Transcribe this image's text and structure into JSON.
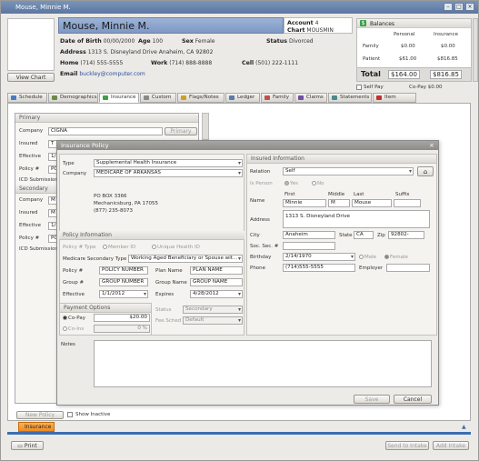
{
  "window": {
    "title": "Mouse, Minnie M."
  },
  "patient": {
    "name": "Mouse, Minnie M.",
    "view_chart": "View Chart",
    "dob_label": "Date of Birth",
    "dob": "00/00/2000",
    "age_label": "Age",
    "age": "100",
    "sex_label": "Sex",
    "sex": "Female",
    "status_label": "Status",
    "status": "Divorced",
    "address_label": "Address",
    "address": "1313 S. Disneyland Drive Anaheim, CA 92802",
    "home_label": "Home",
    "home": "(714) 555-5555",
    "work_label": "Work",
    "work": "(714) 888-8888",
    "cell_label": "Cell",
    "cell": "(501) 222-1111",
    "email_label": "Email",
    "email": "buckley@computer.com",
    "account_label": "Account",
    "account": "4",
    "chart_label": "Chart",
    "chart": "MOUSMIN"
  },
  "balances": {
    "title": "Balances",
    "col1": "Personal",
    "col2": "Insurance",
    "rows": [
      {
        "label": "Family",
        "personal": "$0.00",
        "insurance": "$0.00"
      },
      {
        "label": "Patient",
        "personal": "$61.00",
        "insurance": "$816.85"
      }
    ],
    "total_label": "Total",
    "total_personal": "$164.00",
    "total_insurance": "$816.85",
    "self_pay": "Self Pay",
    "copay": "Co-Pay $0.00"
  },
  "tabs": [
    {
      "label": "Schedule",
      "color": "#4a7ac8"
    },
    {
      "label": "Demographics",
      "color": "#6a8a4a"
    },
    {
      "label": "Insurance",
      "color": "#3aa04a"
    },
    {
      "label": "Custom",
      "color": "#888"
    },
    {
      "label": "Flags/Notes",
      "color": "#d0a020"
    },
    {
      "label": "Ledger",
      "color": "#5a7ab0"
    },
    {
      "label": "Family",
      "color": "#c05050"
    },
    {
      "label": "Claims",
      "color": "#7050a0"
    },
    {
      "label": "Statements",
      "color": "#4a8a8a"
    },
    {
      "label": "Item Charges",
      "color": "#c03030"
    }
  ],
  "left_panel": {
    "primary": "Primary",
    "company_label": "Company",
    "company_val": "CIGNA",
    "primary_btn": "Primary",
    "insured_label": "Insured",
    "insured_val": "T",
    "effective_label": "Effective",
    "effective_val": "1/",
    "policy_label": "Policy #",
    "policy_val": "PO",
    "icd_label": "ICD Submission",
    "secondary": "Secondary",
    "company2_label": "Company",
    "company2_val": "M",
    "insured2_label": "Insured",
    "insured2_val": "M",
    "effective2_label": "Effective",
    "effective2_val": "1/",
    "policy2_label": "Policy #",
    "policy2_val": "PO",
    "icd2_label": "ICD Submission",
    "new_policy": "New Policy",
    "show_inactive": "Show Inactive"
  },
  "dialog": {
    "title": "Insurance Policy",
    "type_label": "Type",
    "type_val": "Supplemental Health Insurance",
    "company_label": "Company",
    "company_val": "MEDICARE OF ARKANSAS",
    "addr1": "PO BOX 3366",
    "addr2": "Mechanicsburg, PA 17055",
    "addr3": "(877) 235-8073",
    "policy_info": "Policy Information",
    "policy_type_label": "Policy # Type",
    "member_id": "Member ID",
    "unique_id": "Unique Health ID",
    "med_sec_label": "Medicare Secondary Type",
    "med_sec_val": "Working Aged Beneficiary or Spouse wit...",
    "policy_num_label": "Policy #",
    "policy_num_val": "POLICY NUMBER",
    "plan_name_label": "Plan Name",
    "plan_name_val": "PLAN NAME",
    "group_num_label": "Group #",
    "group_num_val": "GROUP NUMBER",
    "group_name_label": "Group Name",
    "group_name_val": "GROUP NAME",
    "effective_label": "Effective",
    "effective_val": "1/1/2012",
    "expires_label": "Expires",
    "expires_val": "4/28/2012",
    "payment_options": "Payment Options",
    "copay_label": "Co-Pay",
    "copay_val": "$20.00",
    "coins_label": "Co-Ins",
    "coins_val": "0 %",
    "status_label": "Status",
    "status_val": "Secondary",
    "fee_label": "Fee Sched",
    "fee_val": "Default",
    "insured_info": "Insured Information",
    "relation_label": "Relation",
    "relation_val": "Self",
    "is_person_label": "Is Person",
    "yes": "Yes",
    "no": "No",
    "name_label": "Name",
    "first_h": "First",
    "middle_h": "Middle",
    "last_h": "Last",
    "suffix_h": "Suffix",
    "first_v": "Minnie",
    "middle_v": "M",
    "last_v": "Mouse",
    "suffix_v": "",
    "address_label": "Address",
    "address_val": "1313 S. Disneyland Drive",
    "city_label": "City",
    "city_val": "Anaheim",
    "state_label": "State",
    "state_val": "CA",
    "zip_label": "Zip",
    "zip_val": "92802-",
    "ssn_label": "Soc. Sec. #",
    "ssn_val": "",
    "birthday_label": "Birthday",
    "birthday_val": "2/14/1970",
    "male": "Male",
    "female": "Female",
    "phone_label": "Phone",
    "phone_val": "(714)555-5555",
    "employer_label": "Employer",
    "employer_val": "",
    "notes_label": "Notes",
    "save": "Save",
    "cancel": "Cancel"
  },
  "bottom": {
    "tab": "Insurance",
    "print": "Print",
    "send_to_intake": "Send to Intake",
    "add_intake": "Add Intake"
  }
}
